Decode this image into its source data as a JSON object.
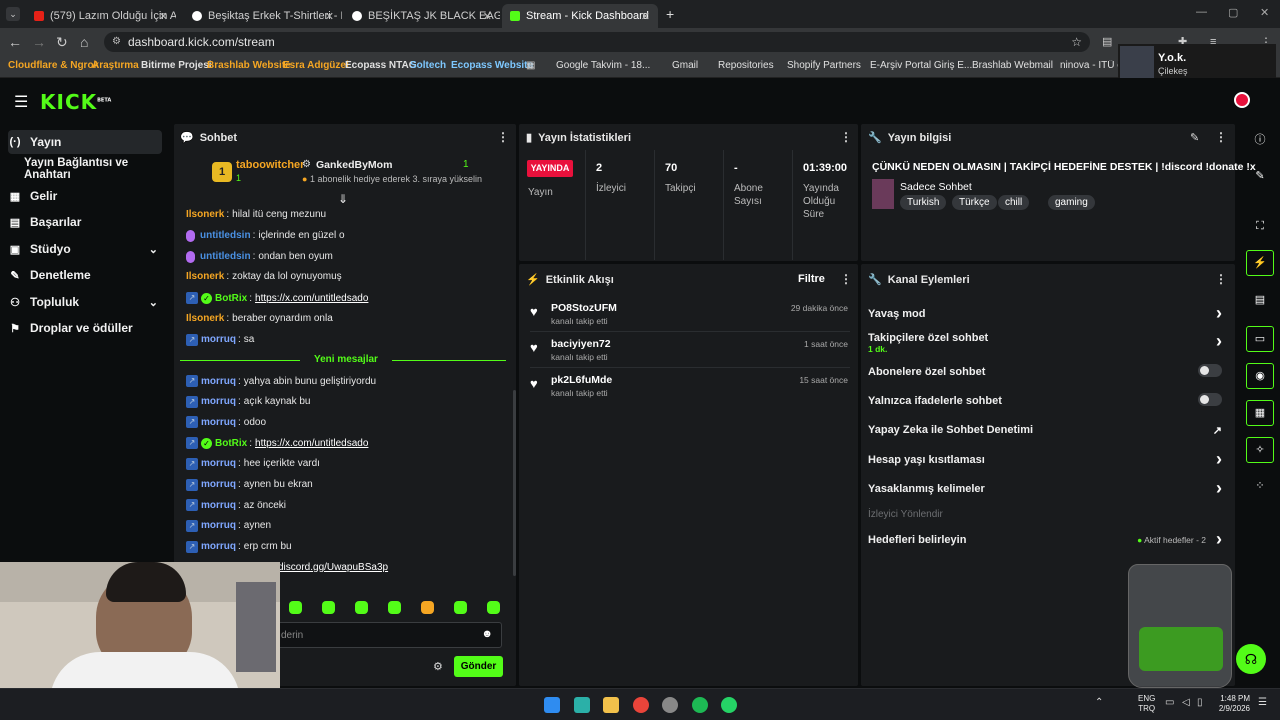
{
  "browser": {
    "tabs": [
      {
        "title": "(579) Lazım Olduğu İçin Aldıkla",
        "fav_color": "#e62117"
      },
      {
        "title": "Beşiktaş Erkek T-Shirtleri - Kart",
        "fav_color": "#ffffff"
      },
      {
        "title": "BEŞİKTAŞ JK BLACK EAGLES SO",
        "fav_color": "#ffffff"
      },
      {
        "title": "Stream - Kick Dashboard",
        "fav_color": "#53fc18"
      }
    ],
    "url": "dashboard.kick.com/stream",
    "bookmarks": [
      "Cloudflare & Ngrok",
      "Araştırma",
      "Bitirme Projesi",
      "Brashlab Website",
      "Esra Adıgüzel",
      "Ecopass NTAG",
      "Soltech",
      "Ecopass Website",
      "Google Takvim - 18...",
      "Gmail",
      "Repositories",
      "Shopify Partners",
      "E-Arşiv Portal Giriş E...",
      "Brashlab Webmail",
      "ninova - İTÜ e-Ö"
    ],
    "profile_name": "Y.o.k.",
    "profile_sub": "Çilekeş"
  },
  "kick": {
    "logo": "KICK",
    "logo_sup": "BETA"
  },
  "nav": [
    {
      "label": "Yayın",
      "icon": "(·)"
    },
    {
      "label": "Yayın Bağlantısı ve Anahtarı",
      "icon": ""
    },
    {
      "label": "Gelir",
      "icon": "▦"
    },
    {
      "label": "Başarılar",
      "icon": "▤"
    },
    {
      "label": "Stüdyo",
      "icon": "▣"
    },
    {
      "label": "Denetleme",
      "icon": "✎"
    },
    {
      "label": "Topluluk",
      "icon": "⚇"
    },
    {
      "label": "Droplar ve ödüller",
      "icon": "⚑"
    }
  ],
  "chat": {
    "title": "Sohbet",
    "pinned": {
      "rank": "1",
      "user": "taboowitcher",
      "count": "1",
      "gifter": "GankedByMom",
      "gift_count": "1",
      "gift_text": "1 abonelik hediye ederek 3. sıraya yükselin"
    },
    "messages_before": [
      {
        "user": "Ilsonerk",
        "text": "hilal itü ceng mezunu",
        "color": "#f5a623",
        "badge": ""
      },
      {
        "user": "untitledsin",
        "text": "içlerinde en güzel o",
        "color": "#4a90e2",
        "badge": "purple"
      },
      {
        "user": "untitledsin",
        "text": "ondan ben oyum",
        "color": "#4a90e2",
        "badge": "purple"
      },
      {
        "user": "Ilsonerk",
        "text": "zoktay da lol oynuyomuş",
        "color": "#f5a623",
        "badge": ""
      },
      {
        "user": "BotRix",
        "text": "https://x.com/untitledsado",
        "color": "#53fc18",
        "badge": "bot",
        "link": true
      },
      {
        "user": "Ilsonerk",
        "text": "beraber oynardım onla",
        "color": "#f5a623",
        "badge": ""
      },
      {
        "user": "morruq",
        "text": "sa",
        "color": "#7fa7ff",
        "badge": "blue"
      }
    ],
    "divider": "Yeni mesajlar",
    "messages_after": [
      {
        "user": "morruq",
        "text": "yahya abin bunu geliştiriyordu",
        "color": "#7fa7ff",
        "badge": "blue"
      },
      {
        "user": "morruq",
        "text": "açık kaynak bu",
        "color": "#7fa7ff",
        "badge": "blue"
      },
      {
        "user": "morruq",
        "text": "odoo",
        "color": "#7fa7ff",
        "badge": "blue"
      },
      {
        "user": "BotRix",
        "text": "https://x.com/untitledsado",
        "color": "#53fc18",
        "badge": "bot",
        "link": true
      },
      {
        "user": "morruq",
        "text": "hee içerikte vardı",
        "color": "#7fa7ff",
        "badge": "blue"
      },
      {
        "user": "morruq",
        "text": "aynen bu ekran",
        "color": "#7fa7ff",
        "badge": "blue"
      },
      {
        "user": "morruq",
        "text": "az önceki",
        "color": "#7fa7ff",
        "badge": "blue"
      },
      {
        "user": "morruq",
        "text": "aynen",
        "color": "#7fa7ff",
        "badge": "blue"
      },
      {
        "user": "morruq",
        "text": "erp crm bu",
        "color": "#7fa7ff",
        "badge": "blue"
      }
    ],
    "partial_link": "discord.gg/UwapuBSa3p",
    "input_placeholder": "derin",
    "send_label": "Gönder"
  },
  "stats": {
    "title": "Yayın İstatistikleri",
    "live_badge": "YAYINDA",
    "live_label": "Yayın",
    "items": [
      {
        "value": "2",
        "label": "İzleyici"
      },
      {
        "value": "70",
        "label": "Takipçi"
      },
      {
        "value": "-",
        "label": "Abone Sayısı"
      },
      {
        "value": "01:39:00",
        "label": "Yayında Olduğu Süre"
      }
    ]
  },
  "info": {
    "title": "Yayın bilgisi",
    "stream_title": "ÇÜNKÜ NEDEN OLMASIN | TAKİPÇİ HEDEFİNE DESTEK | !discord !donate !x",
    "category": "Sadece Sohbet",
    "tags": [
      "Turkish",
      "Türkçe",
      "chill",
      "gaming"
    ]
  },
  "activity": {
    "title": "Etkinlik Akışı",
    "filter_label": "Filtre",
    "events": [
      {
        "user": "PO8StozUFM",
        "action": "kanalı takip etti",
        "time": "29 dakika önce"
      },
      {
        "user": "baciyiyen72",
        "action": "kanalı takip etti",
        "time": "1 saat önce"
      },
      {
        "user": "pk2L6fuMde",
        "action": "kanalı takip etti",
        "time": "15 saat önce"
      }
    ]
  },
  "actions": {
    "title": "Kanal Eylemleri",
    "rows": [
      {
        "label": "Yavaş mod",
        "control": "chevron"
      },
      {
        "label": "Takipçilere özel sohbet",
        "sub": "1 dk.",
        "control": "chevron"
      },
      {
        "label": "Abonelere özel sohbet",
        "control": "toggle"
      },
      {
        "label": "Yalnızca ifadelerle sohbet",
        "control": "toggle"
      },
      {
        "label": "Yapay Zeka ile Sohbet Denetimi",
        "control": "external"
      },
      {
        "label": "Hesap yaşı kısıtlaması",
        "control": "chevron"
      },
      {
        "label": "Yasaklanmış kelimeler",
        "control": "chevron"
      },
      {
        "label": "İzleyici Yönlendir",
        "control": "none",
        "disabled": true
      },
      {
        "label": "Hedefleri belirleyin",
        "control": "chevron",
        "extra": "Aktif hedefler - 2"
      }
    ]
  },
  "taskbar": {
    "lang1": "ENG",
    "lang2": "TRQ",
    "time": "1:48 PM",
    "date": "2/9/2026"
  },
  "colors": {
    "accent": "#53fc18",
    "live": "#e9113c"
  }
}
